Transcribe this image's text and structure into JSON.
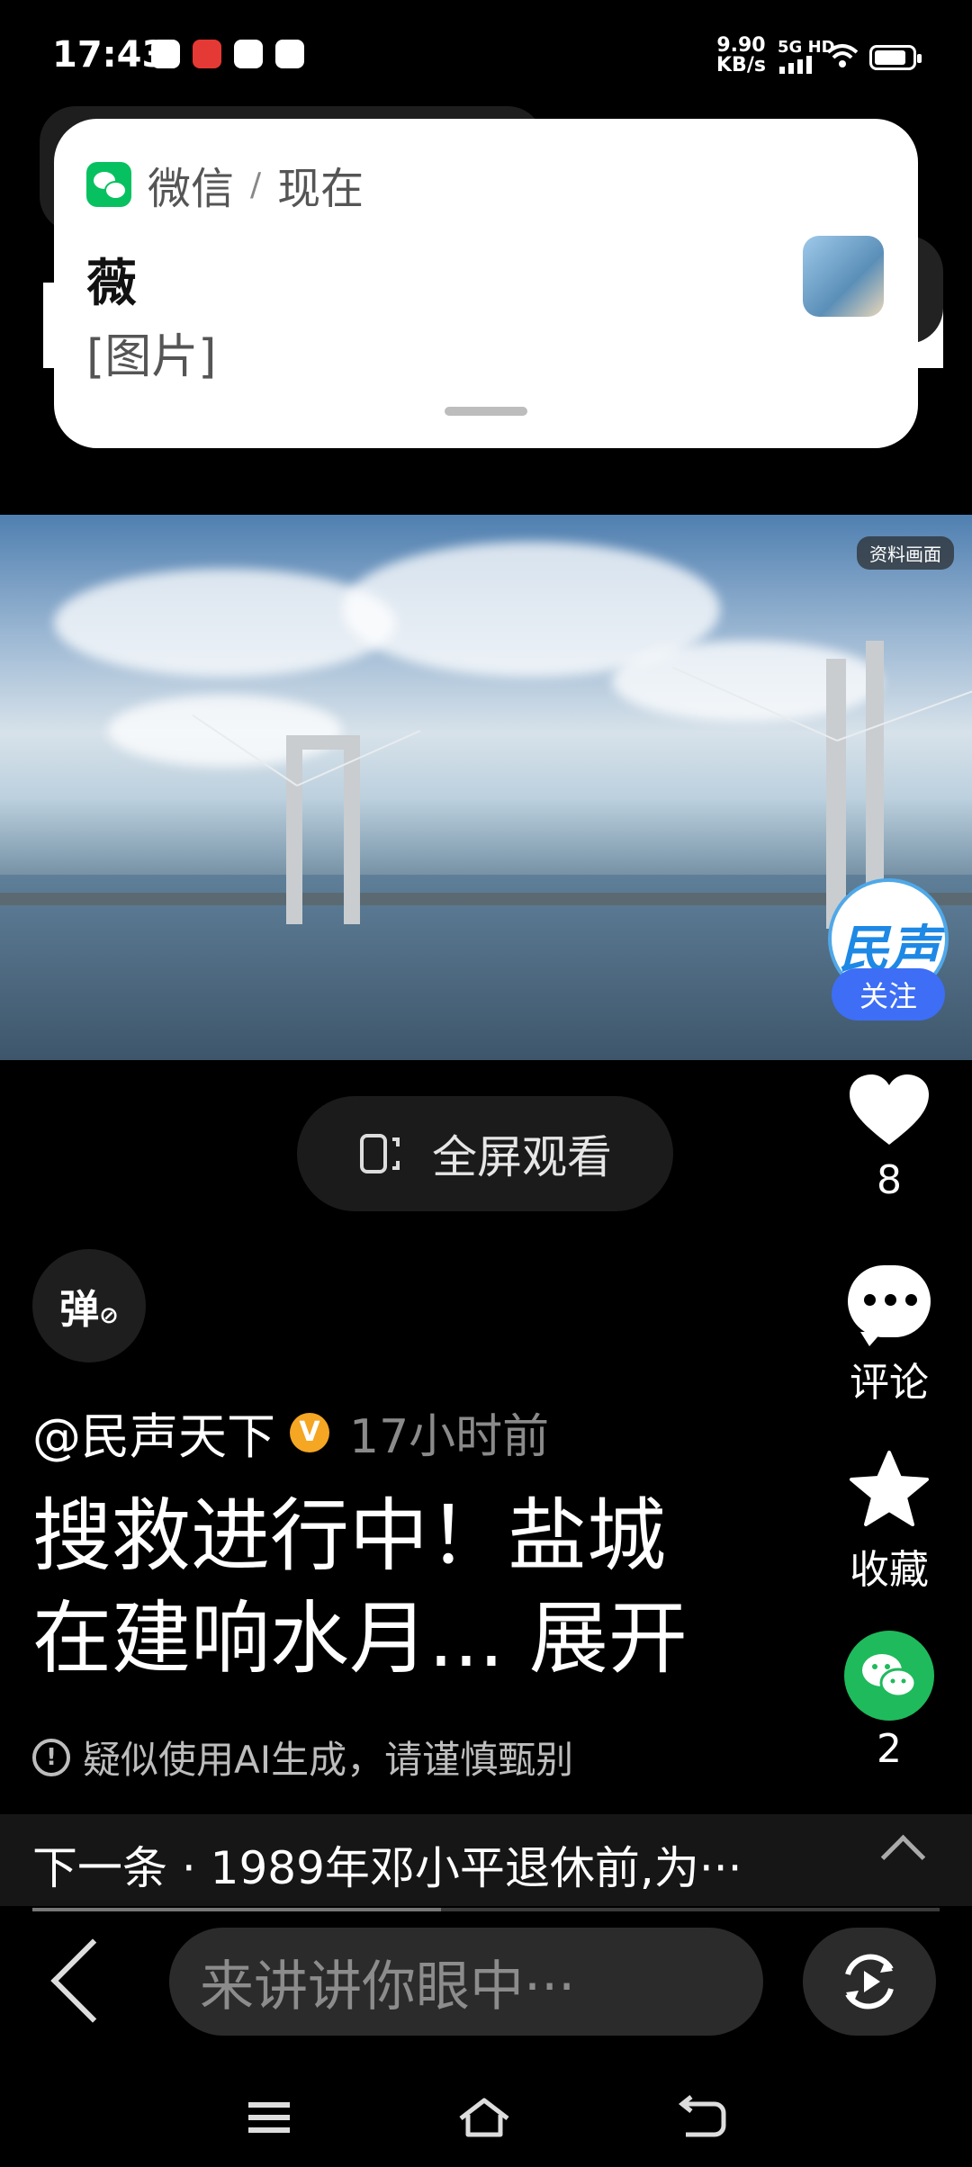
{
  "status_bar": {
    "time": "17:43",
    "net_speed": "9.90",
    "net_speed_unit": "KB/s",
    "network": "5G HD"
  },
  "notification": {
    "app": "微信",
    "separator": "/",
    "when": "现在",
    "sender": "薇",
    "message": "[图片]"
  },
  "video": {
    "tag": "资料画面",
    "channel_logo_text": "民声"
  },
  "follow_label": "关注",
  "fullscreen_label": "全屏观看",
  "danmaku_label": "弹",
  "actions": {
    "like_count": "8",
    "comment_label": "评论",
    "favorite_label": "收藏",
    "share_count": "2"
  },
  "post": {
    "author": "@民声天下",
    "verified_mark": "V",
    "time_ago": "17小时前",
    "title_line1": "搜救进行中！盐城",
    "title_line2": "在建响水月...  展开",
    "ai_warning": "疑似使用AI生成，请谨慎甄别"
  },
  "next": {
    "text": "下一条 · 1989年邓小平退休前,为···"
  },
  "comment_bar": {
    "placeholder": "来讲讲你眼中···"
  },
  "progress_fraction": 0.45
}
